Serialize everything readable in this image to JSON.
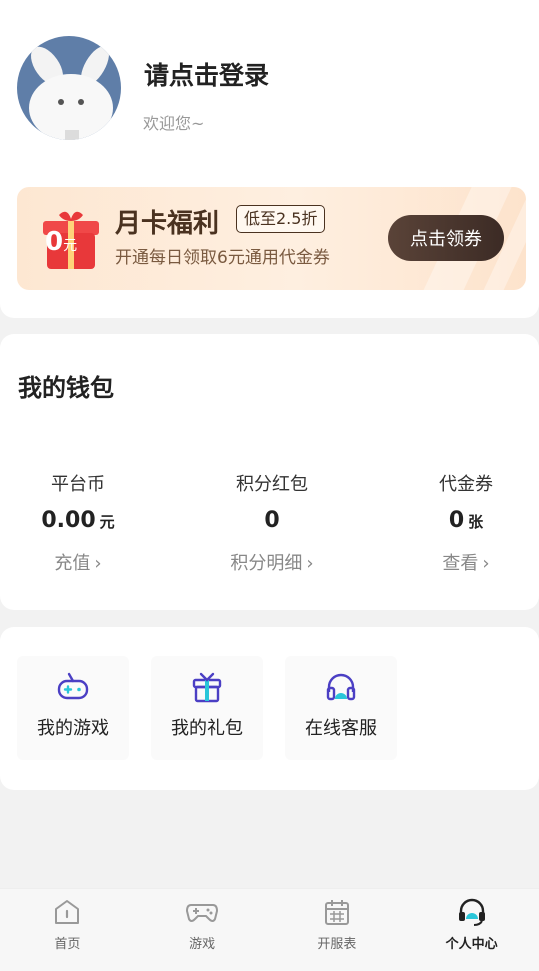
{
  "profile": {
    "login_title": "请点击登录",
    "welcome": "欢迎您~"
  },
  "banner": {
    "price": "0",
    "price_unit": "元",
    "title": "月卡福利",
    "badge": "低至2.5折",
    "subtitle": "开通每日领取6元通用代金券",
    "button": "点击领券"
  },
  "wallet": {
    "title": "我的钱包",
    "items": [
      {
        "label": "平台币",
        "value": "0.00",
        "unit": "元",
        "action": "充值"
      },
      {
        "label": "积分红包",
        "value": "0",
        "unit": "",
        "action": "积分明细"
      },
      {
        "label": "代金券",
        "value": "0",
        "unit": "张",
        "action": "查看"
      }
    ]
  },
  "services": [
    {
      "label": "我的游戏",
      "icon": "gamepad-icon"
    },
    {
      "label": "我的礼包",
      "icon": "gift-box-icon"
    },
    {
      "label": "在线客服",
      "icon": "headset-icon"
    }
  ],
  "tabbar": {
    "active": 3,
    "tabs": [
      {
        "label": "首页",
        "icon": "home-icon"
      },
      {
        "label": "游戏",
        "icon": "gamepad-icon"
      },
      {
        "label": "开服表",
        "icon": "calendar-icon"
      },
      {
        "label": "个人中心",
        "icon": "headset-icon"
      }
    ]
  },
  "colors": {
    "accent_purple": "#4b3fc4",
    "accent_teal": "#29c6d9",
    "banner_button": "#3c2b25"
  }
}
